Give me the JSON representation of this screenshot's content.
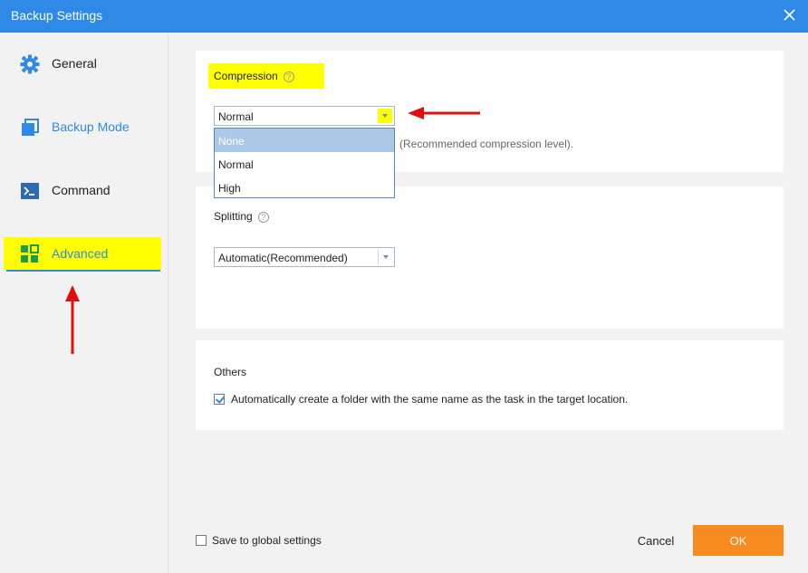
{
  "window": {
    "title": "Backup Settings"
  },
  "sidebar": {
    "items": [
      {
        "label": "General",
        "icon": "gear-icon"
      },
      {
        "label": "Backup Mode",
        "icon": "backup-mode-icon"
      },
      {
        "label": "Command",
        "icon": "command-icon"
      },
      {
        "label": "Advanced",
        "icon": "grid-icon"
      }
    ],
    "selected": "Advanced"
  },
  "compression": {
    "title": "Compression",
    "selected": "Normal",
    "options": [
      "None",
      "Normal",
      "High"
    ],
    "hovered_option": "None",
    "hint": "(Recommended compression level)."
  },
  "splitting": {
    "title": "Splitting",
    "selected": "Automatic(Recommended)"
  },
  "others": {
    "title": "Others",
    "auto_folder_label": "Automatically create a folder with the same name as the task in the target location.",
    "auto_folder_checked": true
  },
  "footer": {
    "save_global_label": "Save to global settings",
    "save_global_checked": false,
    "cancel_label": "Cancel",
    "ok_label": "OK"
  },
  "colors": {
    "accent": "#2e8ae6",
    "ok_button": "#f88b1e",
    "highlight": "#ffff00",
    "annotation_arrow": "#e01010"
  }
}
